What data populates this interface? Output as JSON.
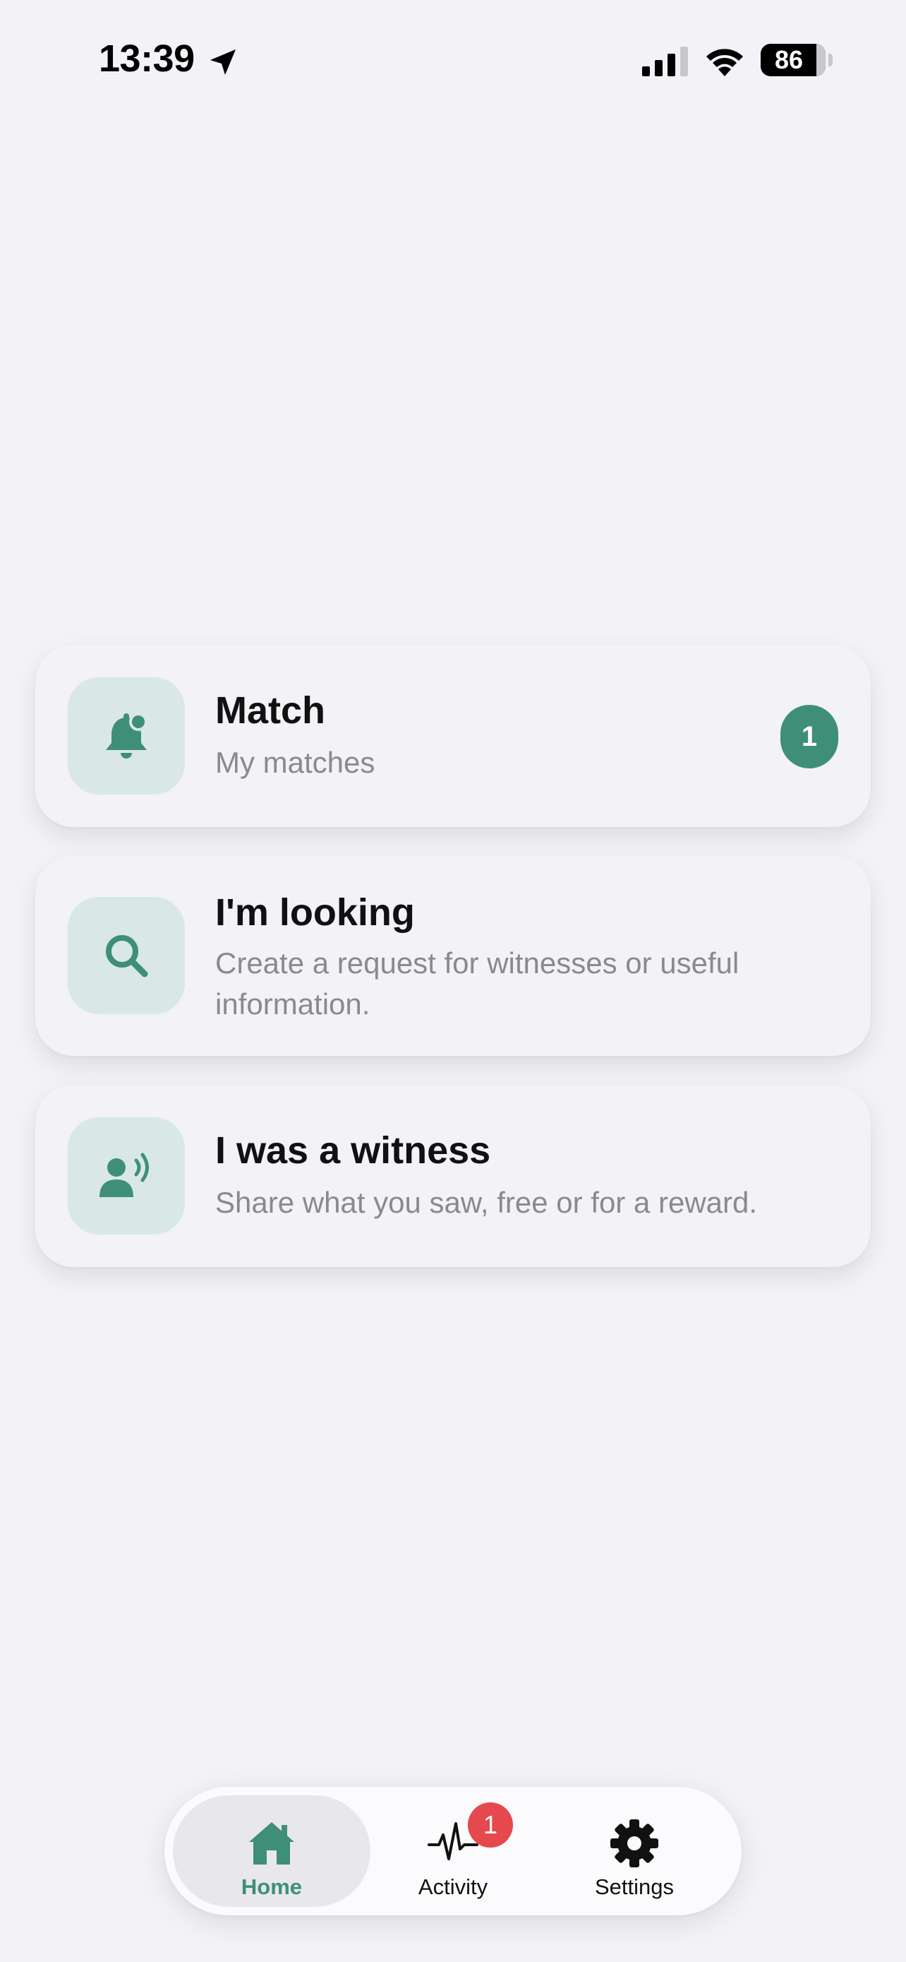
{
  "status_bar": {
    "time": "13:39",
    "battery_percent": "86",
    "icons": [
      "location-arrow-icon",
      "cellular-signal-icon",
      "wifi-icon",
      "battery-icon"
    ]
  },
  "colors": {
    "accent": "#3f8f78",
    "icon_tile": "#d9e8e4",
    "badge_red": "#e5484d",
    "background": "#f2f2f7"
  },
  "cards": [
    {
      "title": "Match",
      "subtitle": "My matches",
      "icon": "bell-icon",
      "badge": "1"
    },
    {
      "title": "I'm looking",
      "subtitle": "Create a request for witnesses or useful information.",
      "icon": "search-icon"
    },
    {
      "title": "I was a witness",
      "subtitle": "Share what you saw, free or for a reward.",
      "icon": "person-speaking-icon"
    }
  ],
  "tab_bar": {
    "active": "Home",
    "items": [
      {
        "label": "Home",
        "icon": "home-icon"
      },
      {
        "label": "Activity",
        "icon": "activity-pulse-icon",
        "badge": "1"
      },
      {
        "label": "Settings",
        "icon": "gear-icon"
      }
    ]
  }
}
